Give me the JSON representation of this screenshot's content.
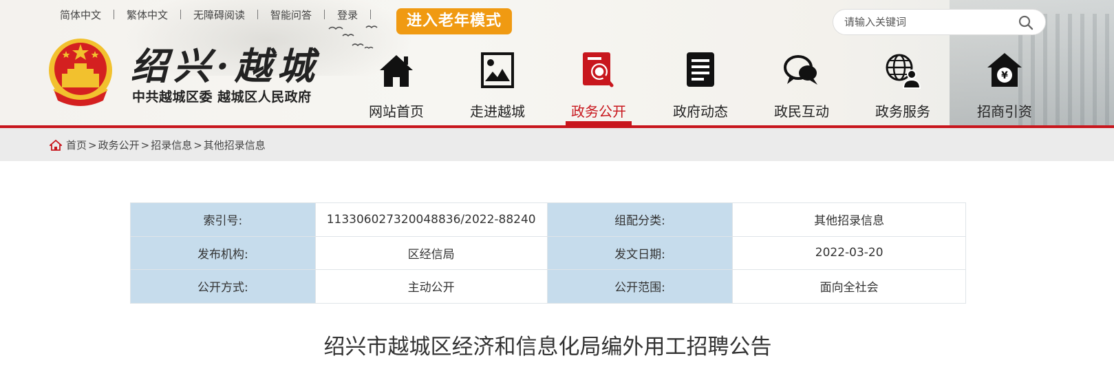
{
  "topbar": {
    "links": [
      "简体中文",
      "繁体中文",
      "无障碍阅读",
      "智能问答",
      "登录"
    ],
    "elder_mode": "进入老年模式"
  },
  "search": {
    "placeholder": "请输入关键词",
    "icon": "search-icon"
  },
  "logo": {
    "title": "绍兴·越城",
    "subtitle": "中共越城区委 越城区人民政府",
    "emblem": "national-emblem-icon"
  },
  "nav": {
    "items": [
      {
        "label": "网站首页",
        "icon": "home-icon"
      },
      {
        "label": "走进越城",
        "icon": "picture-icon"
      },
      {
        "label": "政务公开",
        "icon": "document-search-icon",
        "active": true
      },
      {
        "label": "政府动态",
        "icon": "news-icon"
      },
      {
        "label": "政民互动",
        "icon": "chat-icon"
      },
      {
        "label": "政务服务",
        "icon": "globe-user-icon"
      },
      {
        "label": "招商引资",
        "icon": "investment-house-icon"
      }
    ]
  },
  "breadcrumb": {
    "items": [
      "首页",
      "政务公开",
      "招录信息",
      "其他招录信息"
    ],
    "separator": ">"
  },
  "info": {
    "rows": [
      {
        "k1": "索引号:",
        "v1": "113306027320048836/2022-88240",
        "k2": "组配分类:",
        "v2": "其他招录信息"
      },
      {
        "k1": "发布机构:",
        "v1": "区经信局",
        "k2": "发文日期:",
        "v2": "2022-03-20"
      },
      {
        "k1": "公开方式:",
        "v1": "主动公开",
        "k2": "公开范围:",
        "v2": "面向全社会"
      }
    ]
  },
  "article": {
    "title": "绍兴市越城区经济和信息化局编外用工招聘公告"
  },
  "colors": {
    "accent_red": "#c8161d",
    "elder_orange": "#f09a12",
    "label_bg": "#c6dcec",
    "crumb_bg": "#ebebeb"
  }
}
